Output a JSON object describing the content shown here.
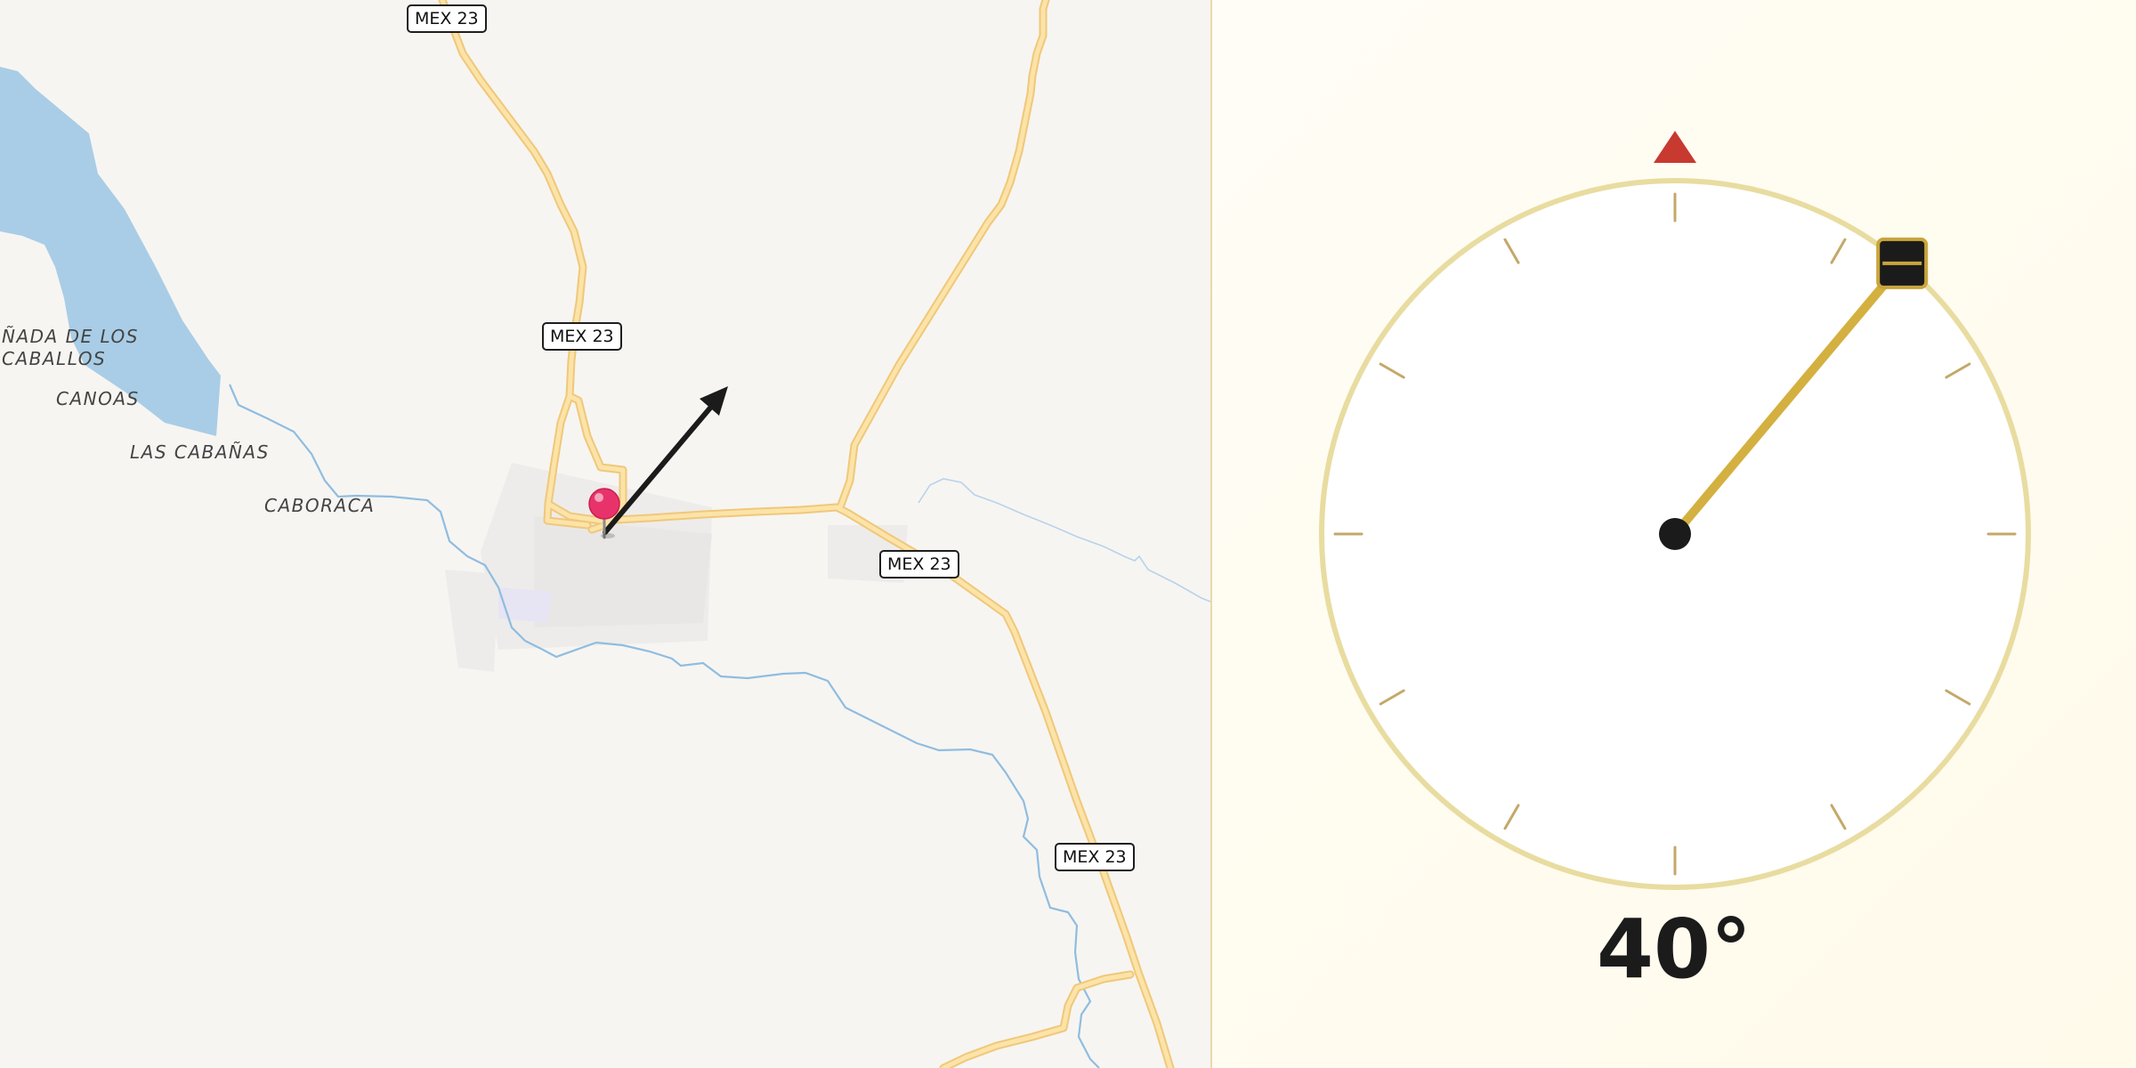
{
  "map": {
    "road_shields": [
      "MEX 23",
      "MEX 23",
      "MEX 23",
      "MEX 23"
    ],
    "place_labels": [
      "ÑADA DE LOS",
      "CABALLOS",
      "CANOAS",
      "LAS CABAÑAS",
      "CABORACA"
    ],
    "colors": {
      "background": "#f7f5f2",
      "water": "#a9cde6",
      "river": "#8fbde0",
      "road_fill": "#fce3a8",
      "road_casing": "#efc87a",
      "urban": "#ecebea",
      "pin": "#e8336a",
      "arrow": "#1b1b1b"
    },
    "marker_icon": "location-pin-icon",
    "direction_icon": "heading-arrow-icon"
  },
  "compass": {
    "heading_label": "40°",
    "heading_value": 40,
    "north_marker_icon": "north-triangle-icon",
    "handle_icon": "drag-handle-icon",
    "colors": {
      "ring": "#e8dca0",
      "tick": "#c4a869",
      "needle": "#d4b040",
      "north": "#c8392f",
      "hub": "#1b1b1b",
      "handle": "#1b1b1b",
      "handle_border": "#c9a53b"
    }
  }
}
